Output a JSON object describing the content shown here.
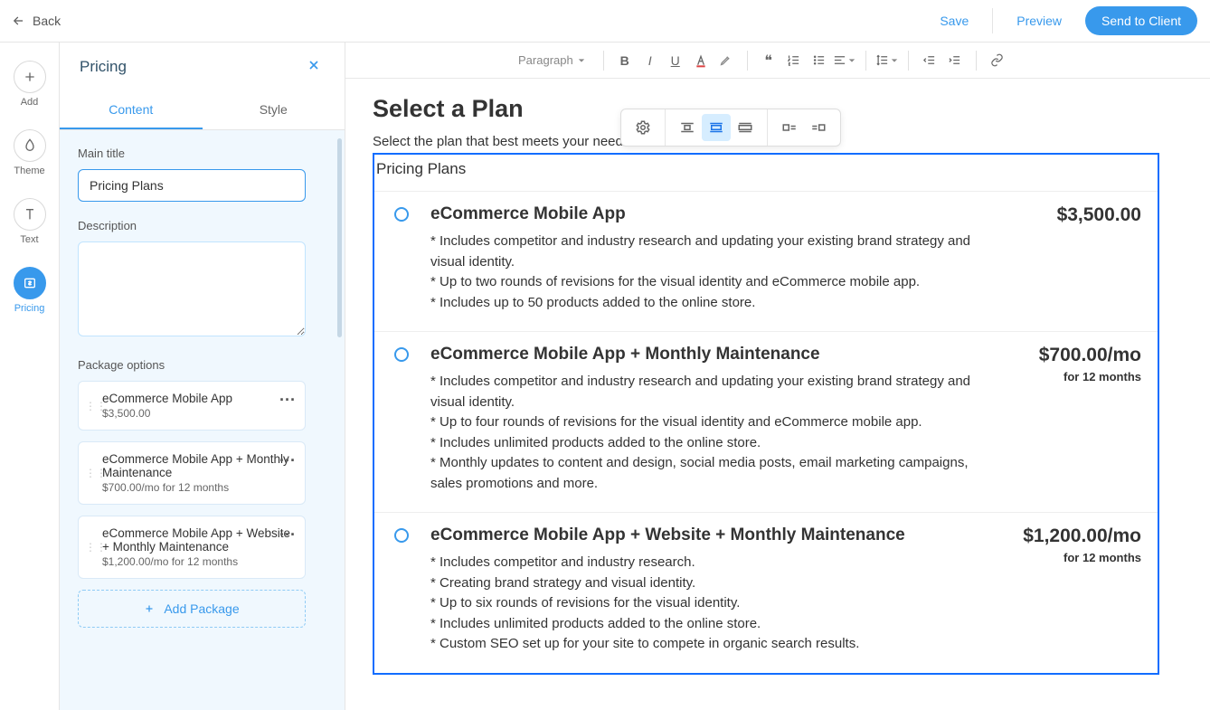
{
  "topbar": {
    "back": "Back",
    "save": "Save",
    "preview": "Preview",
    "send": "Send to Client"
  },
  "rail": {
    "add": "Add",
    "theme": "Theme",
    "text": "Text",
    "pricing": "Pricing"
  },
  "panel": {
    "title": "Pricing",
    "tab_content": "Content",
    "tab_style": "Style",
    "label_main_title": "Main title",
    "main_title_value": "Pricing Plans",
    "label_description": "Description",
    "description_value": "",
    "label_packages": "Package options",
    "packages": [
      {
        "name": "eCommerce Mobile App",
        "price": "$3,500.00"
      },
      {
        "name": "eCommerce Mobile App + Monthly Maintenance",
        "price": "$700.00/mo for 12 months"
      },
      {
        "name": "eCommerce Mobile App + Website + Monthly Maintenance",
        "price": "$1,200.00/mo for 12 months"
      }
    ],
    "add_package": "Add Package"
  },
  "toolbar": {
    "paragraph": "Paragraph"
  },
  "document": {
    "heading": "Select a Plan",
    "subheading": "Select the plan that best meets your needs.",
    "block_title": "Pricing Plans",
    "plans": [
      {
        "name": "eCommerce Mobile App",
        "price": "$3,500.00",
        "term": "",
        "features": "* Includes competitor and industry research and updating your existing brand strategy and visual identity.\n* Up to two rounds of revisions for the visual identity and eCommerce mobile app.\n* Includes up to 50 products added to the online store."
      },
      {
        "name": "eCommerce Mobile App + Monthly Maintenance",
        "price": "$700.00/mo",
        "term": "for 12 months",
        "features": "* Includes competitor and industry research and updating your existing brand strategy and visual identity.\n* Up to four rounds of revisions for the visual identity and eCommerce mobile app.\n* Includes unlimited products added to the online store.\n* Monthly updates to content and design, social media posts, email marketing campaigns, sales promotions and more."
      },
      {
        "name": "eCommerce Mobile App + Website + Monthly Maintenance",
        "price": "$1,200.00/mo",
        "term": "for 12 months",
        "features": "* Includes competitor and industry research.\n* Creating brand strategy and visual identity.\n* Up to six rounds of revisions for the visual identity.\n* Includes unlimited products added to the online store.\n* Custom SEO set up for your site to compete in organic search results."
      }
    ]
  }
}
